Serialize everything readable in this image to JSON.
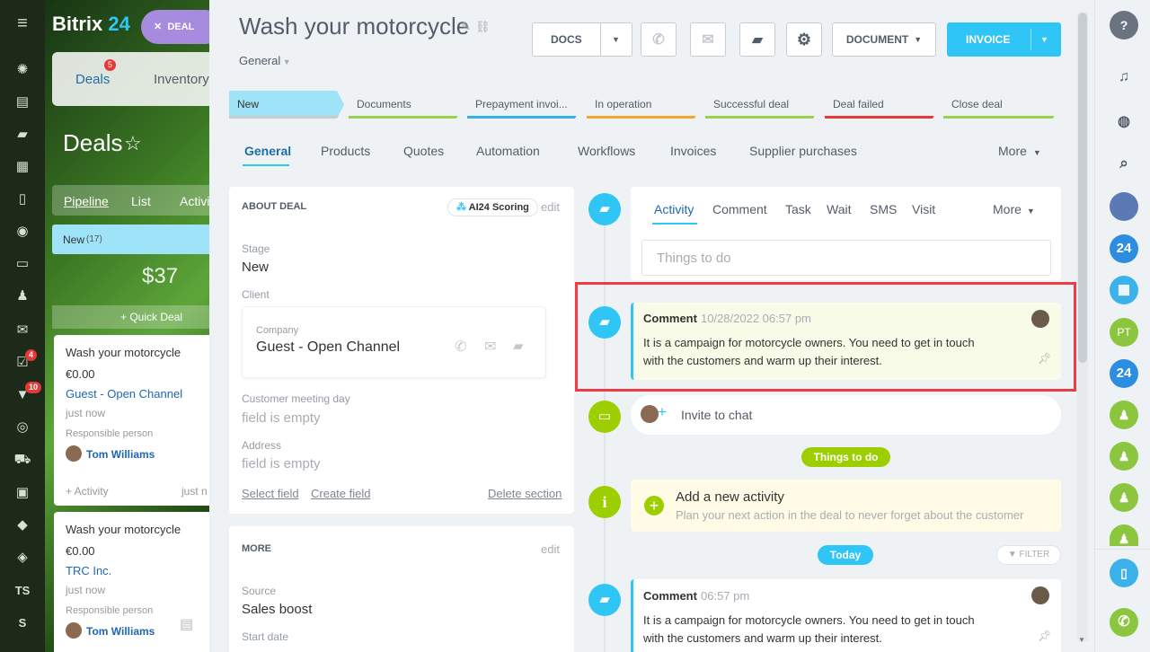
{
  "left_nav": {
    "badge_tasks": "4",
    "badge_feed": "10",
    "ts_label": "TS",
    "s_label": "S"
  },
  "background": {
    "logo_main": "Bitrix",
    "logo_num": "24",
    "deal_button": "DEAL",
    "tab_deals": "Deals",
    "tab_deals_badge": "5",
    "tab_inventory": "Inventory",
    "page_title": "Deals",
    "view_pipeline": "Pipeline",
    "view_list": "List",
    "view_activity": "Activi",
    "column_name": "New",
    "column_count": "(17)",
    "column_sum": "$37",
    "quick_deal": "+ Quick Deal",
    "cards": [
      {
        "title": "Wash your motorcycle",
        "amount": "€0.00",
        "client": "Guest - Open Channel",
        "time": "just now",
        "resp_label": "Responsible person",
        "resp_name": "Tom Williams",
        "activity": "+ Activity",
        "activity_time": "just n"
      },
      {
        "title": "Wash your motorcycle",
        "amount": "€0.00",
        "client": "TRC Inc.",
        "time": "just now",
        "resp_label": "Responsible person",
        "resp_name": "Tom Williams"
      }
    ]
  },
  "header": {
    "title": "Wash your motorcycle",
    "category": "General",
    "docs": "DOCS",
    "document": "DOCUMENT",
    "invoice": "INVOICE"
  },
  "stages": [
    {
      "label": "New",
      "color": "#9ee3f7"
    },
    {
      "label": "Documents",
      "color": "#9ad14b"
    },
    {
      "label": "Prepayment invoi...",
      "color": "#34b3e3"
    },
    {
      "label": "In operation",
      "color": "#f2a72c"
    },
    {
      "label": "Successful deal",
      "color": "#9ad14b"
    },
    {
      "label": "Deal failed",
      "color": "#e53935"
    },
    {
      "label": "Close deal",
      "color": "#9ad14b"
    }
  ],
  "tabs": [
    "General",
    "Products",
    "Quotes",
    "Automation",
    "Workflows",
    "Invoices",
    "Supplier purchases",
    "More"
  ],
  "about": {
    "title": "ABOUT DEAL",
    "ai_badge": "AI24 Scoring",
    "edit": "edit",
    "stage_label": "Stage",
    "stage_value": "New",
    "client_label": "Client",
    "company_label": "Company",
    "company_name": "Guest - Open Channel",
    "meeting_label": "Customer meeting day",
    "meeting_value": "field is empty",
    "address_label": "Address",
    "address_value": "field is empty",
    "select_field": "Select field",
    "create_field": "Create field",
    "delete_section": "Delete section"
  },
  "more_section": {
    "title": "MORE",
    "edit": "edit",
    "source_label": "Source",
    "source_value": "Sales boost",
    "start_label": "Start date"
  },
  "activity": {
    "tabs": [
      "Activity",
      "Comment",
      "Task",
      "Wait",
      "SMS",
      "Visit",
      "More"
    ],
    "placeholder": "Things to do",
    "comment1": {
      "title": "Comment",
      "time": "10/28/2022 06:57 pm",
      "text1": "It is a campaign for motorcycle owners. You need to get in touch",
      "text2": "with the customers and warm up their interest."
    },
    "invite": "Invite to chat",
    "things_badge": "Things to do",
    "add_title": "Add a new activity",
    "add_sub": "Plan your next action in the deal to never forget about the customer",
    "today_badge": "Today",
    "filter": "FILTER",
    "comment2": {
      "title": "Comment",
      "time": "06:57 pm",
      "text1": "It is a campaign for motorcycle owners. You need to get in touch",
      "text2": "with the customers and warm up their interest."
    }
  },
  "right_bar": {
    "help": "?",
    "b24": "24",
    "pt": "PT"
  },
  "colors": {
    "accent": "#2fc6f6",
    "green": "#9dcf00",
    "highlight": "#ef3b44"
  }
}
